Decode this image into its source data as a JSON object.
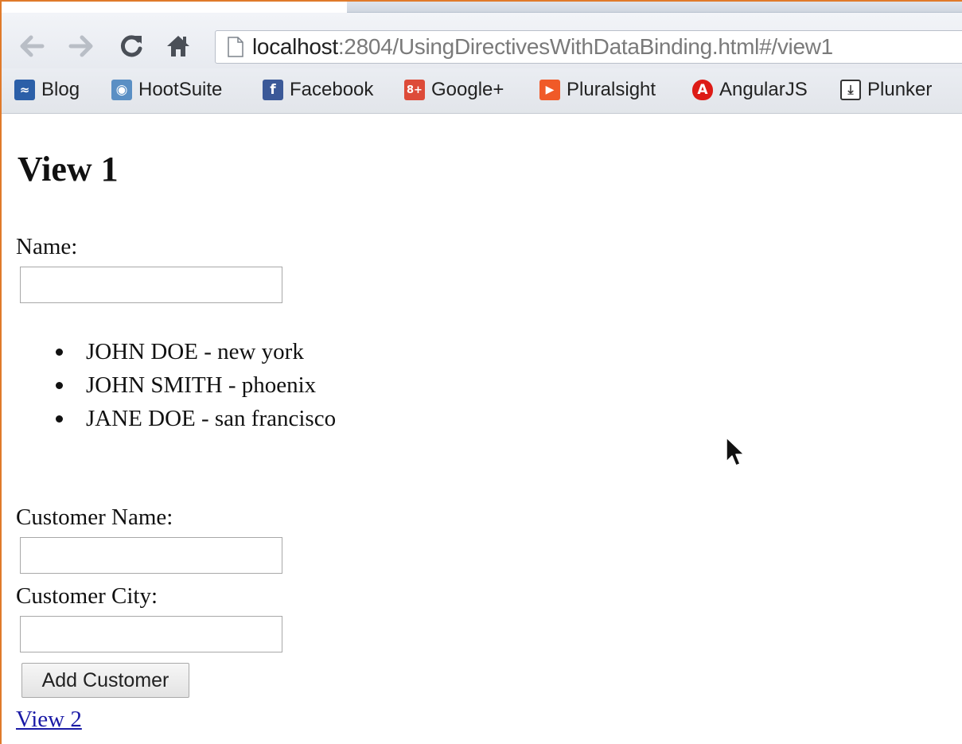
{
  "browser": {
    "url_host": "localhost",
    "url_path": ":2804/UsingDirectivesWithDataBinding.html#/view1",
    "bookmarks": [
      {
        "label": "Blog",
        "icon": "aspnet-icon",
        "color": "#2b5fa8"
      },
      {
        "label": "HootSuite",
        "icon": "hootsuite-owl-icon",
        "color": "#5a8fc4"
      },
      {
        "label": "Facebook",
        "icon": "facebook-icon",
        "color": "#3b5998"
      },
      {
        "label": "Google+",
        "icon": "google-plus-icon",
        "color": "#dd4b39"
      },
      {
        "label": "Pluralsight",
        "icon": "pluralsight-play-icon",
        "color": "#f05a28"
      },
      {
        "label": "AngularJS",
        "icon": "angularjs-shield-icon",
        "color": "#dd1b16"
      },
      {
        "label": "Plunker",
        "icon": "plunker-download-icon",
        "color": "#333333"
      }
    ],
    "bookmark_icon_glyphs": [
      "≈",
      "◉",
      "f",
      "8+",
      "▶",
      "A",
      "⤓"
    ]
  },
  "page": {
    "title": "View 1",
    "name_label": "Name:",
    "name_value": "",
    "customers": [
      {
        "text": "JOHN DOE - new york"
      },
      {
        "text": "JOHN SMITH - phoenix"
      },
      {
        "text": "JANE DOE - san francisco"
      }
    ],
    "customer_name_label": "Customer Name:",
    "customer_city_label": "Customer City:",
    "add_button_label": "Add Customer",
    "view2_link": "View 2"
  },
  "colors": {
    "window_border": "#e07a2a",
    "link": "#1a1aa6"
  }
}
